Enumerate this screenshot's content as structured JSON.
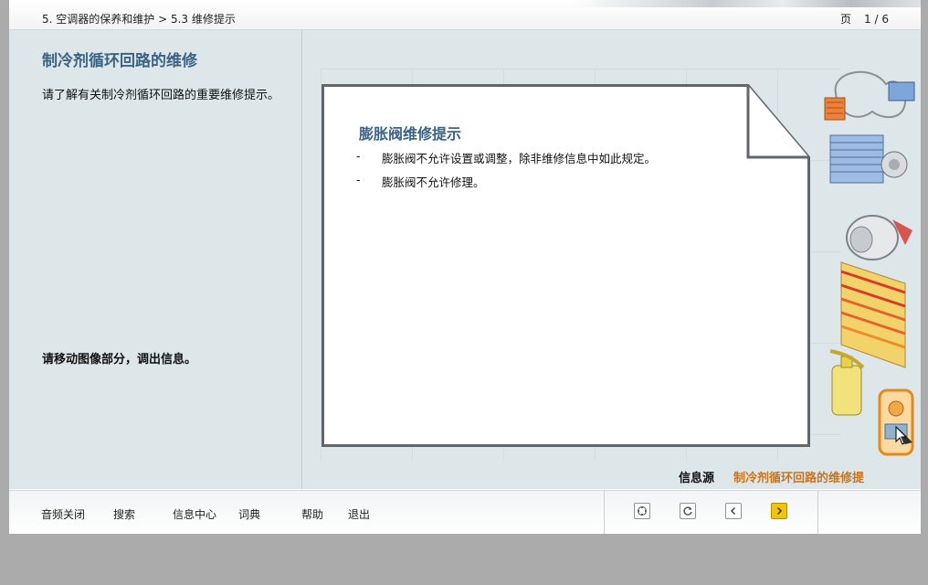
{
  "header": {
    "breadcrumb": "5. 空调器的保养和维护 > 5.3 维修提示",
    "page_label": "页",
    "page_count": "1 / 6"
  },
  "left": {
    "title": "制冷剂循环回路的维修",
    "description": "请了解有关制冷剂循环回路的重要维修提示。",
    "hint": "请移动图像部分，调出信息。"
  },
  "note": {
    "title": "膨胀阀维修提示",
    "items": [
      {
        "bullet": "-",
        "text": "膨胀阀不允许设置或调整，除非维修信息中如此规定。"
      },
      {
        "bullet": "-",
        "text": "膨胀阀不允许修理。"
      }
    ]
  },
  "source": {
    "label": "信息源",
    "link": "制冷剂循环回路的维修提"
  },
  "footer": {
    "menu": [
      "音频关闭",
      "搜索",
      "信息中心",
      "词典",
      "帮助",
      "退出"
    ],
    "nav_icons": [
      "move-icon",
      "reload-icon",
      "previous-icon",
      "next-icon"
    ]
  },
  "colors": {
    "title_blue": "#3a6384",
    "link_orange": "#c8741a",
    "panel_bg": "#dde6e9",
    "active_button": "#f4c400"
  }
}
